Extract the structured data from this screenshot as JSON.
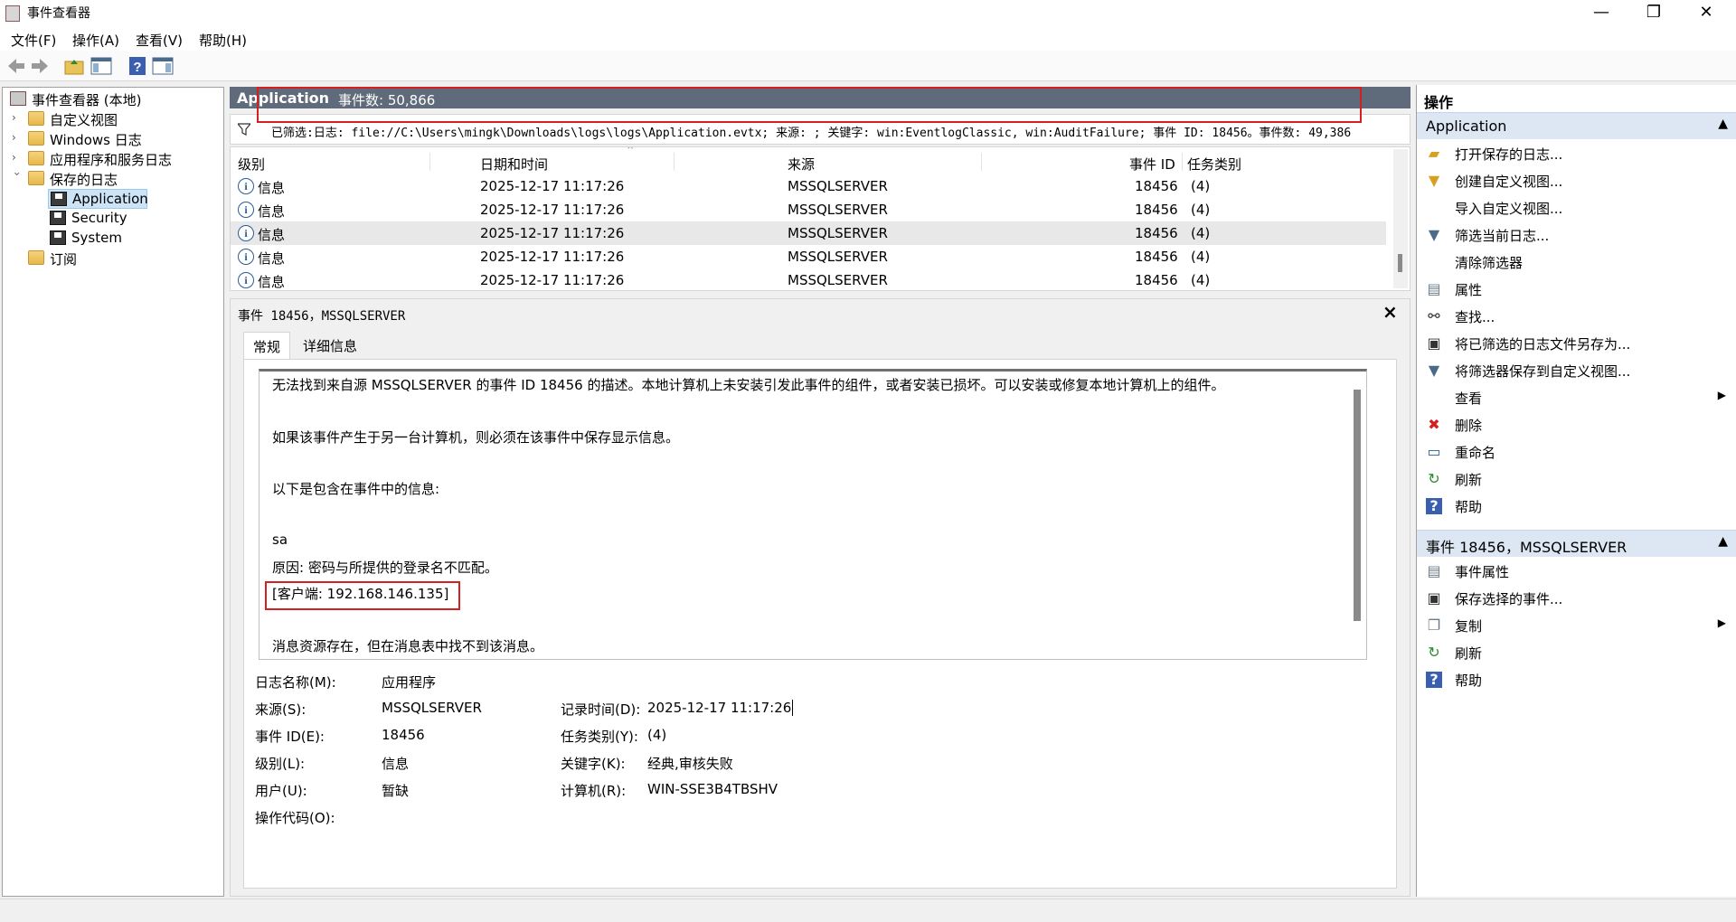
{
  "window": {
    "title": "事件查看器",
    "minimize": "—",
    "maximize": "❐",
    "close": "✕"
  },
  "menu": [
    "文件(F)",
    "操作(A)",
    "查看(V)",
    "帮助(H)"
  ],
  "tree": {
    "root": "事件查看器 (本地)",
    "custom_views": "自定义视图",
    "windows_logs": "Windows 日志",
    "app_service_logs": "应用程序和服务日志",
    "saved_logs": "保存的日志",
    "application": "Application",
    "security": "Security",
    "system": "System",
    "subscriptions": "订阅"
  },
  "header": {
    "title": "Application",
    "count": "事件数: 50,866"
  },
  "filter": {
    "text": "已筛选:日志: file://C:\\Users\\mingk\\Downloads\\logs\\logs\\Application.evtx; 来源: ; 关键字: win:EventlogClassic, win:AuditFailure; 事件 ID: 18456。事件数: 49,386"
  },
  "grid": {
    "columns": {
      "level": "级别",
      "date": "日期和时间",
      "source": "来源",
      "event_id": "事件 ID",
      "task": "任务类别"
    },
    "rows": [
      {
        "level": "信息",
        "date": "2025-12-17 11:17:26",
        "source": "MSSQLSERVER",
        "event_id": "18456",
        "task": "(4)"
      },
      {
        "level": "信息",
        "date": "2025-12-17 11:17:26",
        "source": "MSSQLSERVER",
        "event_id": "18456",
        "task": "(4)"
      },
      {
        "level": "信息",
        "date": "2025-12-17 11:17:26",
        "source": "MSSQLSERVER",
        "event_id": "18456",
        "task": "(4)"
      },
      {
        "level": "信息",
        "date": "2025-12-17 11:17:26",
        "source": "MSSQLSERVER",
        "event_id": "18456",
        "task": "(4)"
      },
      {
        "level": "信息",
        "date": "2025-12-17 11:17:26",
        "source": "MSSQLSERVER",
        "event_id": "18456",
        "task": "(4)"
      }
    ]
  },
  "detail": {
    "title": "事件 18456，MSSQLSERVER",
    "tab_general": "常规",
    "tab_details": "详细信息",
    "message": {
      "line1": "无法找到来自源 MSSQLSERVER 的事件 ID 18456 的描述。本地计算机上未安装引发此事件的组件，或者安装已损坏。可以安装或修复本地计算机上的组件。",
      "line2": "如果该事件产生于另一台计算机，则必须在该事件中保存显示信息。",
      "line3": "以下是包含在事件中的信息:",
      "line4": "sa",
      "line5": " 原因: 密码与所提供的登录名不匹配。",
      "line6": " [客户端: 192.168.146.135]",
      "line7": "消息资源存在，但在消息表中找不到该消息。"
    },
    "fields": {
      "log_name_label": "日志名称(M):",
      "log_name": "应用程序",
      "source_label": "来源(S):",
      "source": "MSSQLSERVER",
      "logged_label": "记录时间(D):",
      "logged": "2025-12-17 11:17:26",
      "event_id_label": "事件 ID(E):",
      "event_id": "18456",
      "task_label": "任务类别(Y):",
      "task": "(4)",
      "level_label": "级别(L):",
      "level": "信息",
      "keywords_label": "关键字(K):",
      "keywords": "经典,审核失败",
      "user_label": "用户(U):",
      "user": "暂缺",
      "computer_label": "计算机(R):",
      "computer": "WIN-SSE3B4TBSHV",
      "opcode_label": "操作代码(O):"
    }
  },
  "actions": {
    "title": "操作",
    "section1": "Application",
    "items1": [
      "打开保存的日志...",
      "创建自定义视图...",
      "导入自定义视图...",
      "筛选当前日志...",
      "清除筛选器",
      "属性",
      "查找...",
      "将已筛选的日志文件另存为...",
      "将筛选器保存到自定义视图...",
      "查看",
      "删除",
      "重命名",
      "刷新",
      "帮助"
    ],
    "section2": "事件 18456，MSSQLSERVER",
    "items2": [
      "事件属性",
      "保存选择的事件...",
      "复制",
      "刷新",
      "帮助"
    ]
  },
  "colors": {
    "header_bg": "#5f6b7a",
    "highlight_red": "#d42020",
    "section_bg": "#dde7f3",
    "selected_bg": "#cde4f7"
  }
}
